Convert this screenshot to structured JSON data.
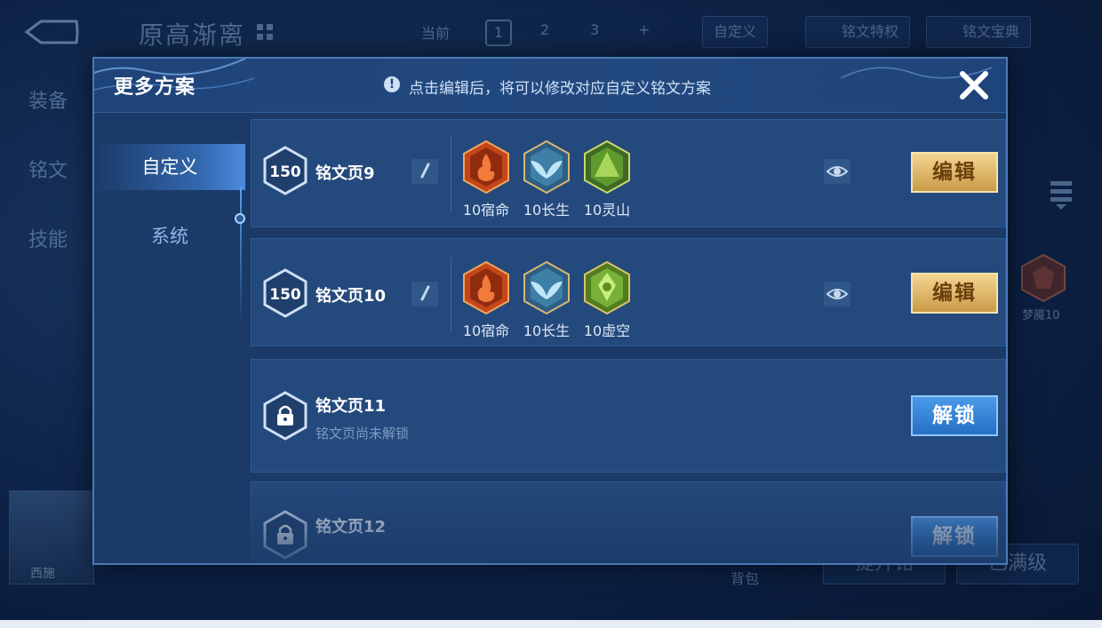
{
  "background": {
    "hero_name": "原高渐离",
    "top_tabs": [
      "当前",
      "1",
      "2",
      "3",
      "+"
    ],
    "buttons": {
      "custom": "自定义",
      "privilege": "铭文特权",
      "codex": "铭文宝典"
    },
    "side_nav": [
      "装备",
      "铭文",
      "技能"
    ],
    "right_rune_label": "梦魇10",
    "avatar_name": "西施",
    "bag_label": "背包",
    "bottom_buttons": [
      "提升铭",
      "已满级"
    ]
  },
  "modal": {
    "title": "更多方案",
    "hint": "点击编辑后，将可以修改对应自定义铭文方案",
    "tabs": [
      {
        "label": "自定义",
        "active": true
      },
      {
        "label": "系统",
        "active": false
      }
    ],
    "pages": [
      {
        "level": "150",
        "name": "铭文页9",
        "locked": false,
        "runes": [
          {
            "label": "10宿命",
            "icon": "red-flame-rune-icon",
            "color": "#d4561d"
          },
          {
            "label": "10长生",
            "icon": "blue-wing-rune-icon",
            "color": "#5fa9c9"
          },
          {
            "label": "10灵山",
            "icon": "green-mountain-rune-icon",
            "color": "#6aa93a"
          }
        ],
        "action": "编辑"
      },
      {
        "level": "150",
        "name": "铭文页10",
        "locked": false,
        "runes": [
          {
            "label": "10宿命",
            "icon": "red-flame-rune-icon",
            "color": "#d4561d"
          },
          {
            "label": "10长生",
            "icon": "blue-wing-rune-icon",
            "color": "#5fa9c9"
          },
          {
            "label": "10虚空",
            "icon": "green-void-rune-icon",
            "color": "#7fb53c"
          }
        ],
        "action": "编辑"
      },
      {
        "name": "铭文页11",
        "subtitle": "铭文页尚未解锁",
        "locked": true,
        "action": "解锁"
      },
      {
        "name": "铭文页12",
        "locked": true,
        "action": "解锁"
      }
    ]
  },
  "colors": {
    "edit_button": "#e2b866",
    "unlock_button": "#3a86d8",
    "modal_bg": "#1b3a68"
  }
}
